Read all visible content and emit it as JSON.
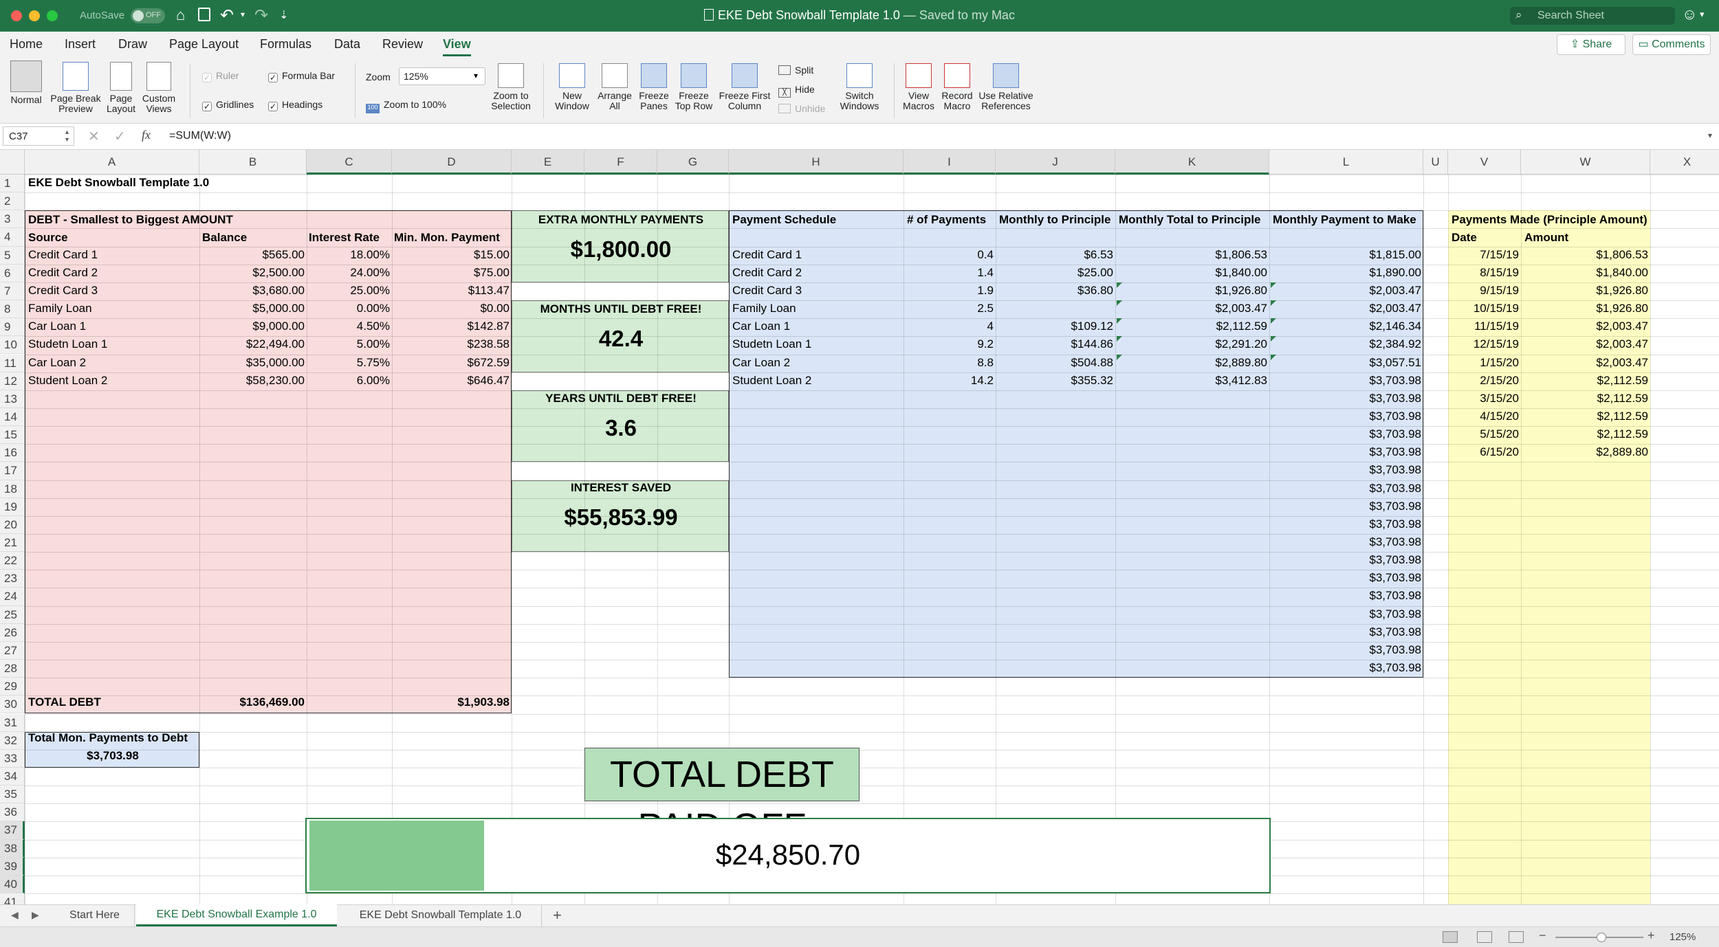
{
  "titlebar": {
    "autosave_label": "AutoSave",
    "autosave_state": "OFF",
    "title": "EKE Debt Snowball Template 1.0",
    "title_suffix": "— Saved to my Mac",
    "search_placeholder": "Search Sheet"
  },
  "ribbon_tabs": [
    "Home",
    "Insert",
    "Draw",
    "Page Layout",
    "Formulas",
    "Data",
    "Review",
    "View"
  ],
  "active_tab": "View",
  "share_label": "Share",
  "comments_label": "Comments",
  "ribbon": {
    "normal": "Normal",
    "page_break_1": "Page Break",
    "page_break_2": "Preview",
    "page_layout_1": "Page",
    "page_layout_2": "Layout",
    "custom_1": "Custom",
    "custom_2": "Views",
    "ruler": "Ruler",
    "formula_bar": "Formula Bar",
    "gridlines": "Gridlines",
    "headings": "Headings",
    "zoom_label": "Zoom",
    "zoom_value": "125%",
    "zoom_100": "Zoom to 100%",
    "zoom_sel_1": "Zoom to",
    "zoom_sel_2": "Selection",
    "new_window_1": "New",
    "new_window_2": "Window",
    "arrange_1": "Arrange",
    "arrange_2": "All",
    "freeze_panes_1": "Freeze",
    "freeze_panes_2": "Panes",
    "freeze_top_1": "Freeze",
    "freeze_top_2": "Top Row",
    "freeze_first_1": "Freeze First",
    "freeze_first_2": "Column",
    "split": "Split",
    "hide": "Hide",
    "unhide": "Unhide",
    "switch_1": "Switch",
    "switch_2": "Windows",
    "view_macros_1": "View",
    "view_macros_2": "Macros",
    "record_1": "Record",
    "record_2": "Macro",
    "relative_1": "Use Relative",
    "relative_2": "References"
  },
  "formula": {
    "cell_ref": "C37",
    "fx": "fx",
    "content": "=SUM(W:W)"
  },
  "columns": [
    "A",
    "B",
    "C",
    "D",
    "E",
    "F",
    "G",
    "H",
    "I",
    "J",
    "K",
    "L",
    "U",
    "V",
    "W",
    "X"
  ],
  "rows": [
    "1",
    "2",
    "3",
    "4",
    "5",
    "6",
    "7",
    "8",
    "9",
    "10",
    "11",
    "12",
    "13",
    "14",
    "15",
    "16",
    "17",
    "18",
    "19",
    "20",
    "21",
    "22",
    "23",
    "24",
    "25",
    "26",
    "27",
    "28",
    "29",
    "30",
    "31",
    "32",
    "33",
    "34",
    "35",
    "36",
    "37",
    "38",
    "39",
    "40",
    "41"
  ],
  "sheet_title": "EKE Debt Snowball Template 1.0",
  "debt": {
    "header": "DEBT - Smallest to Biggest AMOUNT",
    "col_headers": [
      "Source",
      "Balance",
      "Interest Rate",
      "Min. Mon. Payment"
    ],
    "rows": [
      [
        "Credit Card 1",
        "$565.00",
        "18.00%",
        "$15.00"
      ],
      [
        "Credit Card 2",
        "$2,500.00",
        "24.00%",
        "$75.00"
      ],
      [
        "Credit Card 3",
        "$3,680.00",
        "25.00%",
        "$113.47"
      ],
      [
        "Family Loan",
        "$5,000.00",
        "0.00%",
        "$0.00"
      ],
      [
        "Car Loan 1",
        "$9,000.00",
        "4.50%",
        "$142.87"
      ],
      [
        "Studetn Loan 1",
        "$22,494.00",
        "5.00%",
        "$238.58"
      ],
      [
        "Car Loan 2",
        "$35,000.00",
        "5.75%",
        "$672.59"
      ],
      [
        "Student Loan 2",
        "$58,230.00",
        "6.00%",
        "$646.47"
      ]
    ],
    "total_label": "TOTAL DEBT",
    "total_balance": "$136,469.00",
    "total_min": "$1,903.98"
  },
  "total_mon": {
    "label": "Total Mon. Payments to Debt",
    "value": "$3,703.98"
  },
  "summary": [
    {
      "label": "EXTRA MONTHLY PAYMENTS",
      "value": "$1,800.00"
    },
    {
      "label": "MONTHS UNTIL DEBT FREE!",
      "value": "42.4"
    },
    {
      "label": "YEARS UNTIL DEBT FREE!",
      "value": "3.6"
    },
    {
      "label": "INTEREST SAVED",
      "value": "$55,853.99"
    }
  ],
  "schedule": {
    "col_headers": [
      "Payment Schedule",
      "# of Payments",
      "Monthly to Principle",
      "Monthly Total to Principle",
      "Monthly Payment to Make"
    ],
    "rows": [
      [
        "Credit Card 1",
        "0.4",
        "$6.53",
        "$1,806.53",
        "$1,815.00"
      ],
      [
        "Credit Card 2",
        "1.4",
        "$25.00",
        "$1,840.00",
        "$1,890.00"
      ],
      [
        "Credit Card 3",
        "1.9",
        "$36.80",
        "$1,926.80",
        "$2,003.47"
      ],
      [
        "Family Loan",
        "2.5",
        "",
        "$2,003.47",
        "$2,003.47"
      ],
      [
        "Car Loan 1",
        "4",
        "$109.12",
        "$2,112.59",
        "$2,146.34"
      ],
      [
        "Studetn Loan 1",
        "9.2",
        "$144.86",
        "$2,291.20",
        "$2,384.92"
      ],
      [
        "Car Loan 2",
        "8.8",
        "$504.88",
        "$2,889.80",
        "$3,057.51"
      ],
      [
        "Student Loan 2",
        "14.2",
        "$355.32",
        "$3,412.83",
        "$3,703.98"
      ]
    ],
    "repeat_value": "$3,703.98"
  },
  "payments": {
    "header": "Payments Made (Principle Amount)",
    "col_headers": [
      "Date",
      "Amount"
    ],
    "rows": [
      [
        "7/15/19",
        "$1,806.53"
      ],
      [
        "8/15/19",
        "$1,840.00"
      ],
      [
        "9/15/19",
        "$1,926.80"
      ],
      [
        "10/15/19",
        "$1,926.80"
      ],
      [
        "11/15/19",
        "$2,003.47"
      ],
      [
        "12/15/19",
        "$2,003.47"
      ],
      [
        "1/15/20",
        "$2,003.47"
      ],
      [
        "2/15/20",
        "$2,112.59"
      ],
      [
        "3/15/20",
        "$2,112.59"
      ],
      [
        "4/15/20",
        "$2,112.59"
      ],
      [
        "5/15/20",
        "$2,112.59"
      ],
      [
        "6/15/20",
        "$2,889.80"
      ]
    ]
  },
  "paid_off": {
    "label": "TOTAL DEBT PAID OFF",
    "value": "$24,850.70",
    "progress_fraction": 0.182
  },
  "sheet_tabs": [
    "Start Here",
    "EKE Debt Snowball Example 1.0",
    "EKE Debt Snowball Template 1.0"
  ],
  "active_sheet": "EKE Debt Snowball Example 1.0",
  "status": {
    "zoom": "125%"
  },
  "colors": {
    "excel_green": "#227447",
    "debt_pink": "#f9dcdc",
    "summary_green": "#d3ecd3",
    "schedule_blue": "#dae6f7",
    "payments_yellow": "#fdfdc3",
    "progress_fill": "#84c98f",
    "totals_blue": "#dae6f7"
  }
}
